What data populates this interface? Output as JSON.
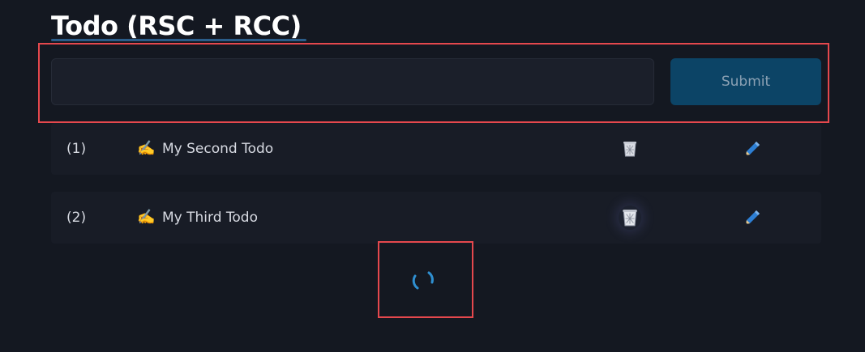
{
  "header": {
    "title": "Todo (RSC + RCC)"
  },
  "form": {
    "input_value": "",
    "input_placeholder": "",
    "submit_label": "Submit"
  },
  "todos": [
    {
      "index": "(1)",
      "emoji": "✍️",
      "text": "My Second Todo",
      "delete_icon": "trash-icon",
      "edit_icon": "pen-icon"
    },
    {
      "index": "(2)",
      "emoji": "✍️",
      "text": "My Third Todo",
      "delete_icon": "trash-icon",
      "edit_icon": "pen-icon"
    }
  ],
  "colors": {
    "background": "#141821",
    "accent": "#0c4466",
    "highlight": "#e5484d",
    "spinner": "#2f8fd0"
  },
  "loading": {
    "icon": "spinner-icon"
  }
}
